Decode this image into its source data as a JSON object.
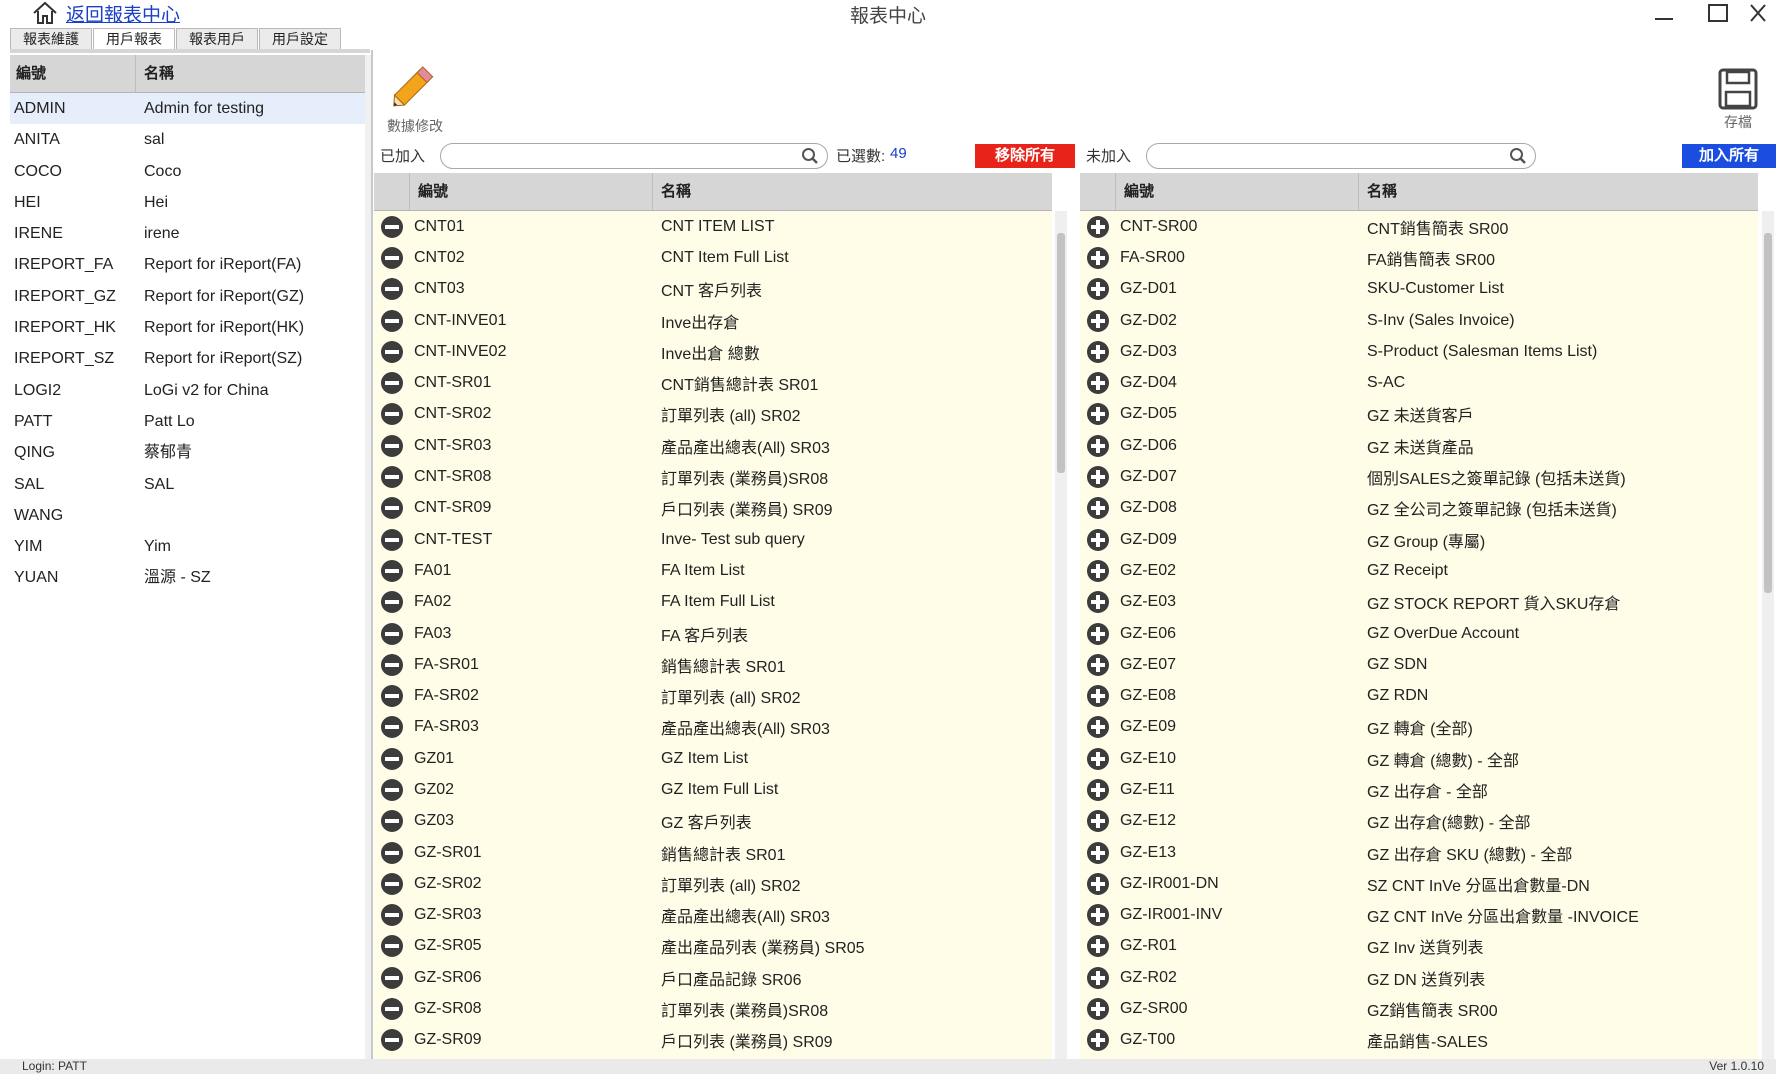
{
  "window": {
    "back_link": "返回報表中心",
    "title": "報表中心"
  },
  "tabs": [
    {
      "label": "報表維護"
    },
    {
      "label": "用戶報表",
      "active": true
    },
    {
      "label": "報表用戶"
    },
    {
      "label": "用戶設定"
    }
  ],
  "users": {
    "header_code": "編號",
    "header_name": "名稱",
    "rows": [
      {
        "code": "ADMIN",
        "name": "Admin for testing",
        "selected": true
      },
      {
        "code": "ANITA",
        "name": "sal"
      },
      {
        "code": "COCO",
        "name": "Coco"
      },
      {
        "code": "HEI",
        "name": "Hei"
      },
      {
        "code": "IRENE",
        "name": "irene"
      },
      {
        "code": "IREPORT_FA",
        "name": "Report for iReport(FA)"
      },
      {
        "code": "IREPORT_GZ",
        "name": "Report for iReport(GZ)"
      },
      {
        "code": "IREPORT_HK",
        "name": "Report for iReport(HK)"
      },
      {
        "code": "IREPORT_SZ",
        "name": "Report for iReport(SZ)"
      },
      {
        "code": "LOGI2",
        "name": "LoGi v2 for China"
      },
      {
        "code": "PATT",
        "name": "Patt Lo"
      },
      {
        "code": "QING",
        "name": "蔡郁青"
      },
      {
        "code": "SAL",
        "name": "SAL"
      },
      {
        "code": "WANG",
        "name": ""
      },
      {
        "code": "YIM",
        "name": "Yim"
      },
      {
        "code": "YUAN",
        "name": "溫源 - SZ"
      }
    ]
  },
  "toolbar": {
    "edit_label": "數據修改",
    "save_label": "存檔",
    "icons": {
      "edit": "pencil-icon",
      "save": "floppy-disk-icon"
    }
  },
  "added": {
    "label": "已加入",
    "search_placeholder": "",
    "count_label": "已選數:",
    "count_value": "49",
    "remove_all_label": "移除所有",
    "header_code": "編號",
    "header_name": "名稱",
    "row_icon": "remove-icon",
    "rows": [
      {
        "code": "CNT01",
        "name": "CNT ITEM LIST"
      },
      {
        "code": "CNT02",
        "name": "CNT Item Full List"
      },
      {
        "code": "CNT03",
        "name": "CNT 客戶列表"
      },
      {
        "code": "CNT-INVE01",
        "name": "Inve出存倉"
      },
      {
        "code": "CNT-INVE02",
        "name": "Inve出倉 總數"
      },
      {
        "code": "CNT-SR01",
        "name": "CNT銷售總計表 SR01"
      },
      {
        "code": "CNT-SR02",
        "name": "訂單列表 (all) SR02"
      },
      {
        "code": "CNT-SR03",
        "name": "產品產出總表(All) SR03"
      },
      {
        "code": "CNT-SR08",
        "name": "訂單列表 (業務員)SR08"
      },
      {
        "code": "CNT-SR09",
        "name": "戶口列表 (業務員) SR09"
      },
      {
        "code": "CNT-TEST",
        "name": "Inve- Test sub query"
      },
      {
        "code": "FA01",
        "name": "FA Item List"
      },
      {
        "code": "FA02",
        "name": "FA Item Full List"
      },
      {
        "code": "FA03",
        "name": "FA 客戶列表"
      },
      {
        "code": "FA-SR01",
        "name": "銷售總計表 SR01"
      },
      {
        "code": "FA-SR02",
        "name": "訂單列表 (all) SR02"
      },
      {
        "code": "FA-SR03",
        "name": "產品產出總表(All) SR03"
      },
      {
        "code": "GZ01",
        "name": "GZ Item List"
      },
      {
        "code": "GZ02",
        "name": "GZ Item Full List"
      },
      {
        "code": "GZ03",
        "name": "GZ 客戶列表"
      },
      {
        "code": "GZ-SR01",
        "name": "銷售總計表 SR01"
      },
      {
        "code": "GZ-SR02",
        "name": "訂單列表 (all) SR02"
      },
      {
        "code": "GZ-SR03",
        "name": "產品產出總表(All) SR03"
      },
      {
        "code": "GZ-SR05",
        "name": "產出產品列表 (業務員) SR05"
      },
      {
        "code": "GZ-SR06",
        "name": "戶口產品記錄 SR06"
      },
      {
        "code": "GZ-SR08",
        "name": "訂單列表 (業務員)SR08"
      },
      {
        "code": "GZ-SR09",
        "name": "戶口列表 (業務員) SR09"
      }
    ]
  },
  "not_added": {
    "label": "未加入",
    "search_placeholder": "",
    "add_all_label": "加入所有",
    "header_code": "編號",
    "header_name": "名稱",
    "row_icon": "add-icon",
    "rows": [
      {
        "code": "CNT-SR00",
        "name": "CNT銷售簡表 SR00"
      },
      {
        "code": "FA-SR00",
        "name": "FA銷售簡表 SR00"
      },
      {
        "code": "GZ-D01",
        "name": "SKU-Customer List"
      },
      {
        "code": "GZ-D02",
        "name": "S-Inv (Sales Invoice)"
      },
      {
        "code": "GZ-D03",
        "name": "S-Product (Salesman Items List)"
      },
      {
        "code": "GZ-D04",
        "name": "S-AC"
      },
      {
        "code": "GZ-D05",
        "name": "GZ 未送貨客戶"
      },
      {
        "code": "GZ-D06",
        "name": "GZ 未送貨產品"
      },
      {
        "code": "GZ-D07",
        "name": "個別SALES之簽單記錄 (包括未送貨)"
      },
      {
        "code": "GZ-D08",
        "name": "GZ 全公司之簽單記錄 (包括未送貨)"
      },
      {
        "code": "GZ-D09",
        "name": "GZ Group (專屬)"
      },
      {
        "code": "GZ-E02",
        "name": "GZ Receipt"
      },
      {
        "code": "GZ-E03",
        "name": "GZ STOCK REPORT 貨入SKU存倉"
      },
      {
        "code": "GZ-E06",
        "name": "GZ OverDue Account"
      },
      {
        "code": "GZ-E07",
        "name": "GZ SDN"
      },
      {
        "code": "GZ-E08",
        "name": "GZ RDN"
      },
      {
        "code": "GZ-E09",
        "name": "GZ 轉倉 (全部)"
      },
      {
        "code": "GZ-E10",
        "name": "GZ 轉倉 (總數) - 全部"
      },
      {
        "code": "GZ-E11",
        "name": "GZ 出存倉 - 全部"
      },
      {
        "code": "GZ-E12",
        "name": "GZ 出存倉(總數) - 全部"
      },
      {
        "code": "GZ-E13",
        "name": "GZ 出存倉 SKU (總數) - 全部"
      },
      {
        "code": "GZ-IR001-DN",
        "name": "SZ CNT InVe 分區出倉數量-DN"
      },
      {
        "code": "GZ-IR001-INV",
        "name": "GZ CNT InVe 分區出倉數量 -INVOICE"
      },
      {
        "code": "GZ-R01",
        "name": "GZ Inv 送貨列表"
      },
      {
        "code": "GZ-R02",
        "name": "GZ DN 送貨列表"
      },
      {
        "code": "GZ-SR00",
        "name": "GZ銷售簡表 SR00"
      },
      {
        "code": "GZ-T00",
        "name": "產品銷售-SALES"
      }
    ]
  },
  "status": {
    "login": "Login: PATT",
    "version": "Ver 1.0.10"
  }
}
